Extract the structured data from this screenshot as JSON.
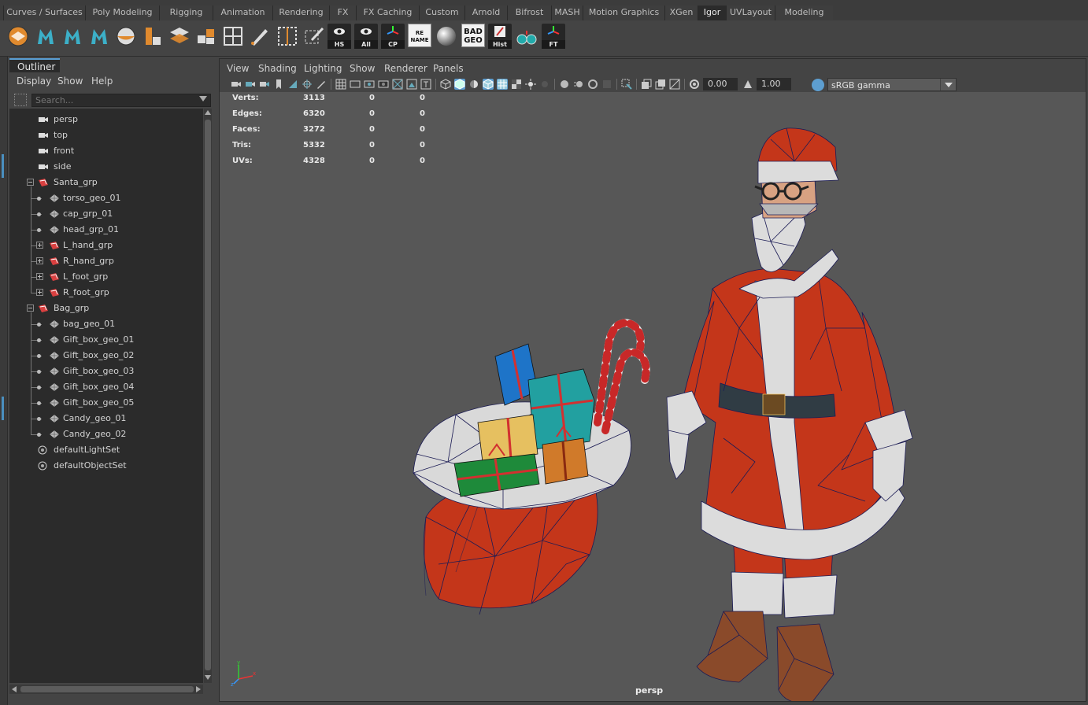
{
  "shelf_tabs": [
    {
      "label": "Curves / Surfaces",
      "active": false
    },
    {
      "label": "Poly Modeling",
      "active": false
    },
    {
      "label": "Rigging",
      "active": false
    },
    {
      "label": "Animation",
      "active": false
    },
    {
      "label": "Rendering",
      "active": false
    },
    {
      "label": "FX",
      "active": false
    },
    {
      "label": "FX Caching",
      "active": false
    },
    {
      "label": "Custom",
      "active": false
    },
    {
      "label": "Arnold",
      "active": false
    },
    {
      "label": "Bifrost",
      "active": false
    },
    {
      "label": "MASH",
      "active": false
    },
    {
      "label": "Motion Graphics",
      "active": false
    },
    {
      "label": "XGen",
      "active": false
    },
    {
      "label": "Igor",
      "active": true
    },
    {
      "label": "UVLayout",
      "active": false
    },
    {
      "label": "Modeling",
      "active": false
    }
  ],
  "shelf_buttons": {
    "hs": "HS",
    "all": "All",
    "cp": "CP",
    "rename_line1": "RE",
    "rename_line2": "NAME",
    "badgeo_line1": "BAD",
    "badgeo_line2": "GEO",
    "hist": "Hist",
    "ft": "FT"
  },
  "outliner": {
    "tab_title": "Outliner",
    "menu": [
      "Display",
      "Show",
      "Help"
    ],
    "search_placeholder": "Search...",
    "items": [
      {
        "label": "persp",
        "type": "camera",
        "depth": 0
      },
      {
        "label": "top",
        "type": "camera",
        "depth": 0
      },
      {
        "label": "front",
        "type": "camera",
        "depth": 0
      },
      {
        "label": "side",
        "type": "camera",
        "depth": 0
      },
      {
        "label": "Santa_grp",
        "type": "group",
        "depth": 0,
        "expanded": true
      },
      {
        "label": "torso_geo_01",
        "type": "mesh",
        "depth": 1
      },
      {
        "label": "cap_grp_01",
        "type": "mesh",
        "depth": 1
      },
      {
        "label": "head_grp_01",
        "type": "mesh",
        "depth": 1
      },
      {
        "label": "L_hand_grp",
        "type": "group",
        "depth": 1,
        "expanded": false
      },
      {
        "label": "R_hand_grp",
        "type": "group",
        "depth": 1,
        "expanded": false
      },
      {
        "label": "L_foot_grp",
        "type": "group",
        "depth": 1,
        "expanded": false
      },
      {
        "label": "R_foot_grp",
        "type": "group",
        "depth": 1,
        "expanded": false
      },
      {
        "label": "Bag_grp",
        "type": "group",
        "depth": 0,
        "expanded": true
      },
      {
        "label": "bag_geo_01",
        "type": "mesh",
        "depth": 1
      },
      {
        "label": "Gift_box_geo_01",
        "type": "mesh",
        "depth": 1
      },
      {
        "label": "Gift_box_geo_02",
        "type": "mesh",
        "depth": 1
      },
      {
        "label": "Gift_box_geo_03",
        "type": "mesh",
        "depth": 1
      },
      {
        "label": "Gift_box_geo_04",
        "type": "mesh",
        "depth": 1
      },
      {
        "label": "Gift_box_geo_05",
        "type": "mesh",
        "depth": 1
      },
      {
        "label": "Candy_geo_01",
        "type": "mesh",
        "depth": 1
      },
      {
        "label": "Candy_geo_02",
        "type": "mesh",
        "depth": 1
      },
      {
        "label": "defaultLightSet",
        "type": "set",
        "depth": 0
      },
      {
        "label": "defaultObjectSet",
        "type": "set",
        "depth": 0
      }
    ]
  },
  "viewport": {
    "menu": [
      "View",
      "Shading",
      "Lighting",
      "Show",
      "Renderer",
      "Panels"
    ],
    "exposure": "0.00",
    "gamma": "1.00",
    "color_space": "sRGB gamma",
    "camera": "persp",
    "hud": [
      {
        "label": "Verts:",
        "total": "3113",
        "selected": "0",
        "triangles": "0"
      },
      {
        "label": "Edges:",
        "total": "6320",
        "selected": "0",
        "triangles": "0"
      },
      {
        "label": "Faces:",
        "total": "3272",
        "selected": "0",
        "triangles": "0"
      },
      {
        "label": "Tris:",
        "total": "5332",
        "selected": "0",
        "triangles": "0"
      },
      {
        "label": "UVs:",
        "total": "4328",
        "selected": "0",
        "triangles": "0"
      }
    ]
  },
  "colors": {
    "accent": "#5d9ed0",
    "santa_red": "#c8361c",
    "fur_white": "#dcdcdc",
    "wire": "#20205a",
    "viewport_bg": "#575757"
  }
}
